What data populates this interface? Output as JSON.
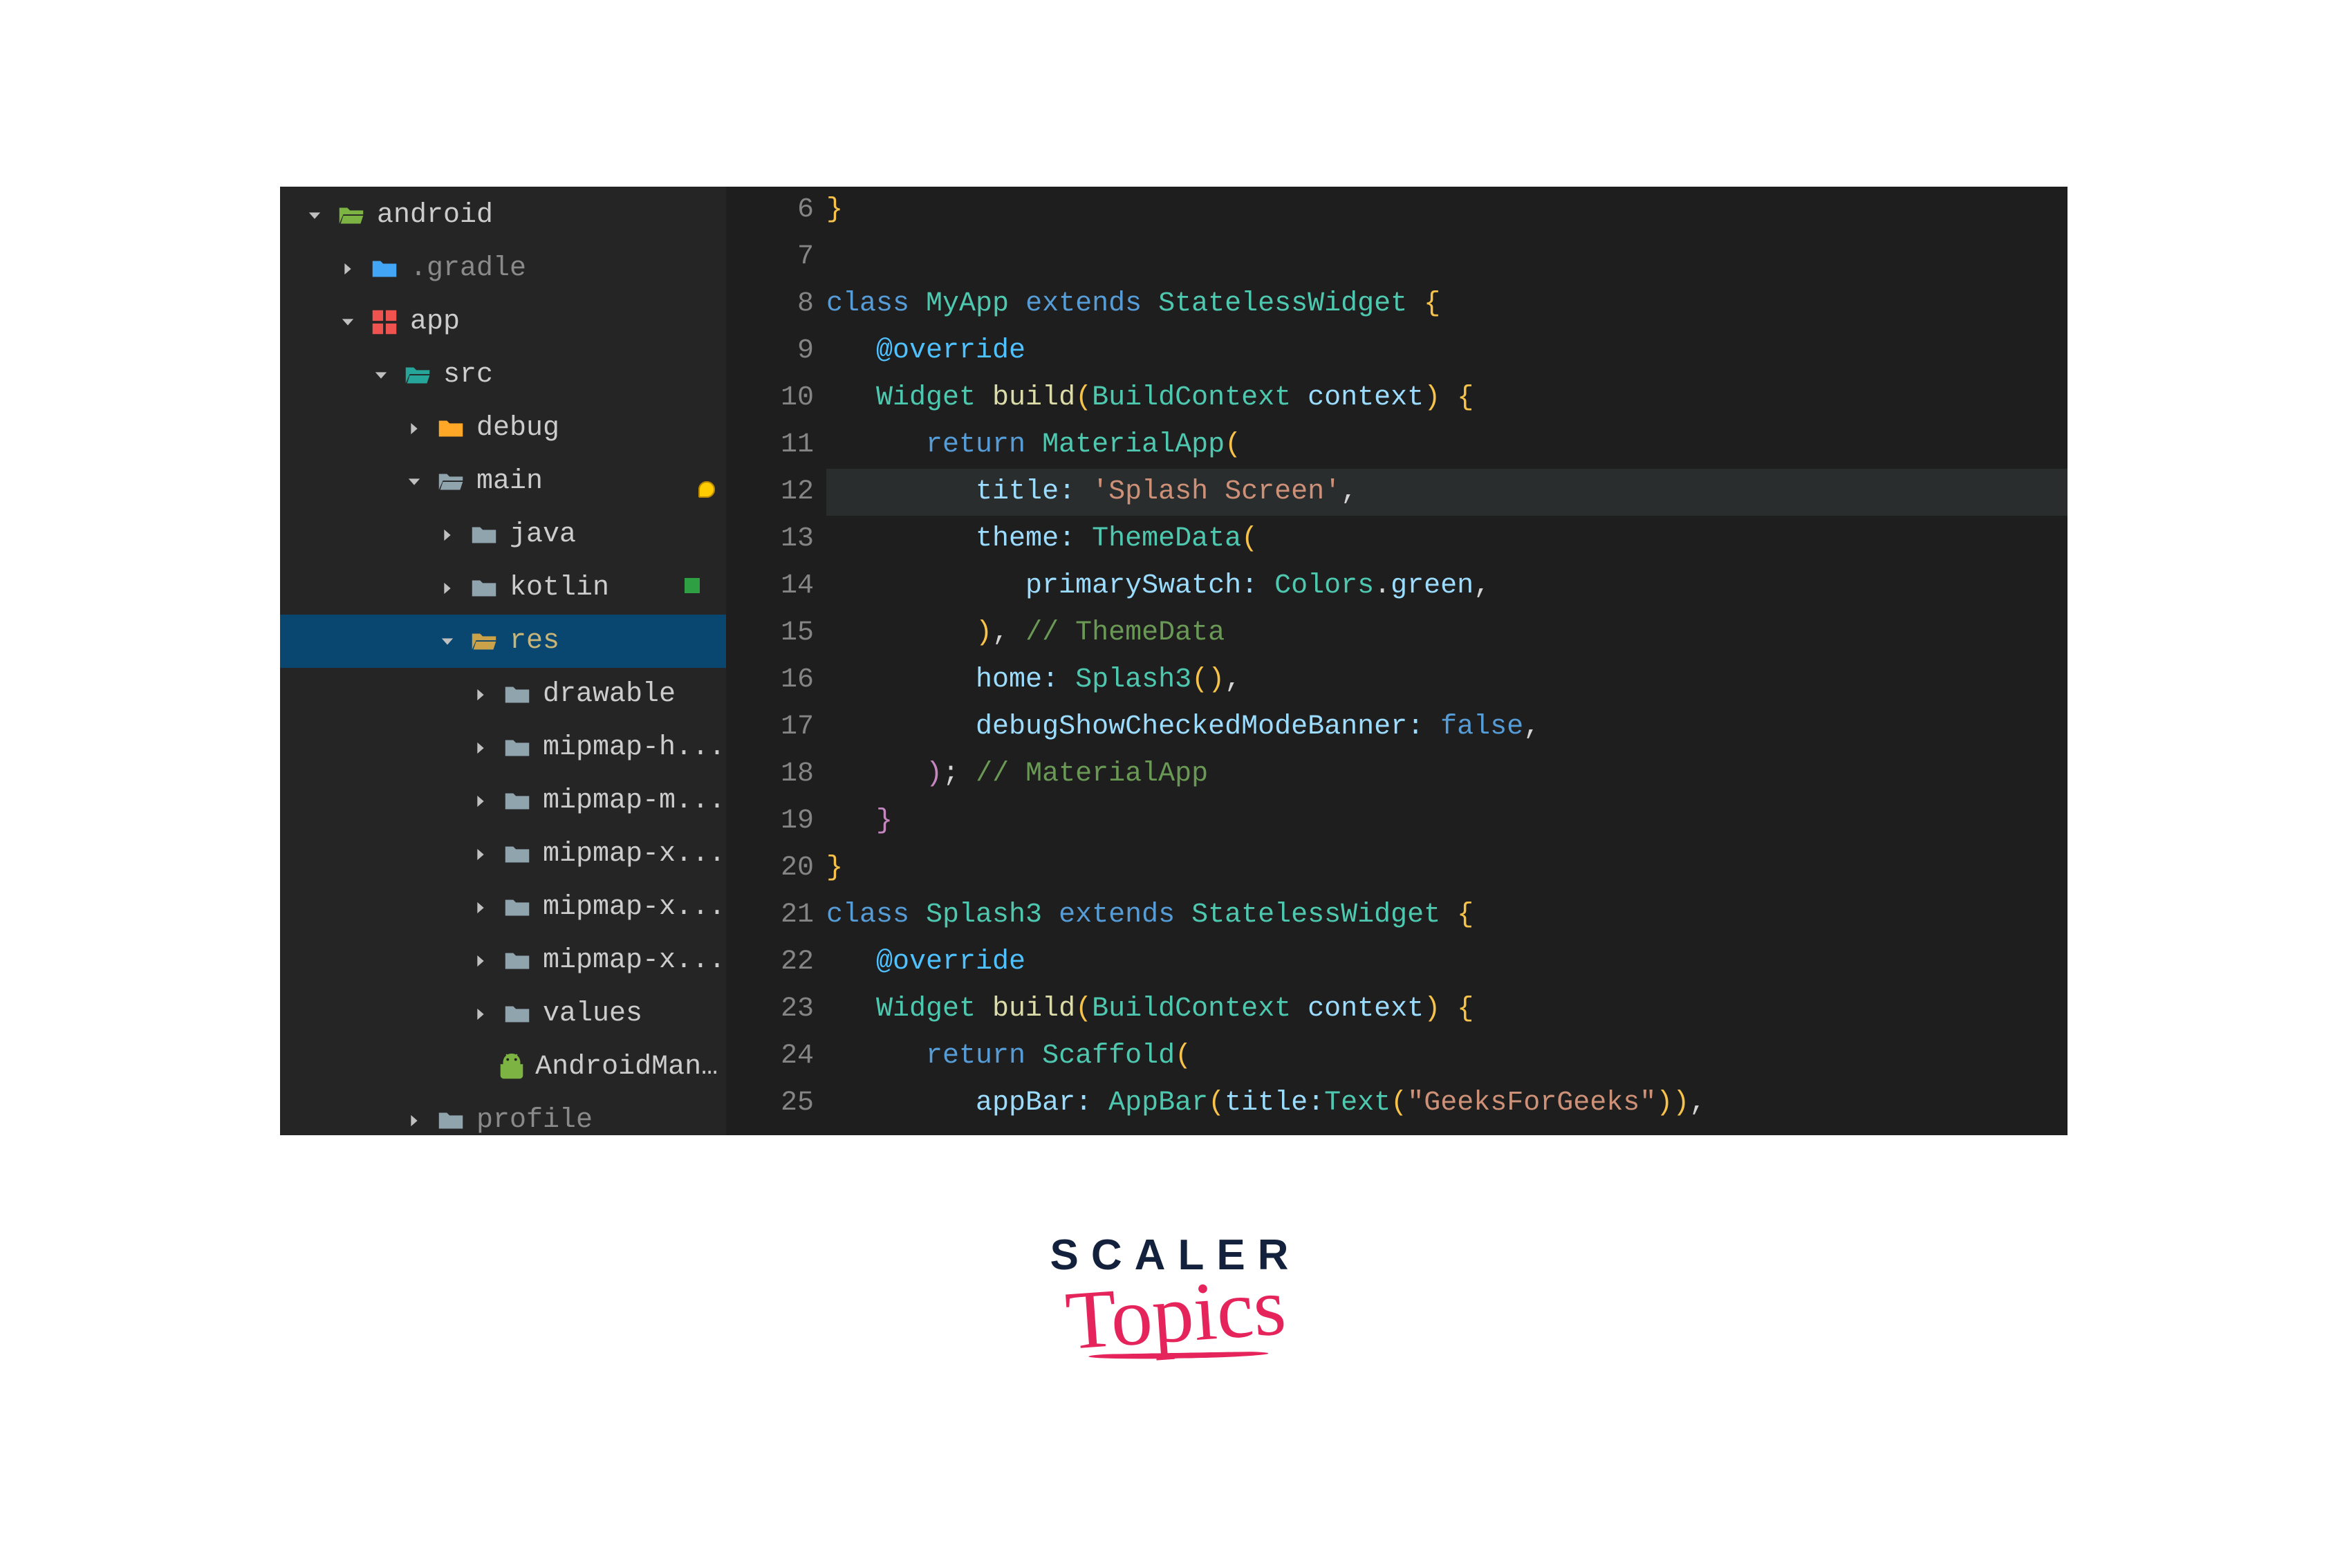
{
  "logo": {
    "line1": "SCALER",
    "line2": "Topics"
  },
  "tree": [
    {
      "depth": 0,
      "twisty": "down",
      "iconColor": "#7cb342",
      "iconType": "folder-open",
      "label": "android",
      "selected": false
    },
    {
      "depth": 1,
      "twisty": "right",
      "iconColor": "#42a5f5",
      "iconType": "folder",
      "label": ".gradle",
      "fade": true
    },
    {
      "depth": 1,
      "twisty": "down",
      "iconColor": "#ef5350",
      "iconType": "grid",
      "label": "app"
    },
    {
      "depth": 2,
      "twisty": "down",
      "iconColor": "#26a69a",
      "iconType": "folder-open",
      "label": "src"
    },
    {
      "depth": 3,
      "twisty": "right",
      "iconColor": "#ffa726",
      "iconType": "folder",
      "label": "debug"
    },
    {
      "depth": 3,
      "twisty": "down",
      "iconColor": "#90a4ae",
      "iconType": "folder-open",
      "label": "main"
    },
    {
      "depth": 4,
      "twisty": "right",
      "iconColor": "#90a4ae",
      "iconType": "folder",
      "label": "java"
    },
    {
      "depth": 4,
      "twisty": "right",
      "iconColor": "#90a4ae",
      "iconType": "folder",
      "label": "kotlin"
    },
    {
      "depth": 4,
      "twisty": "down",
      "iconColor": "#c9a24a",
      "iconType": "folder-open",
      "label": "res",
      "selected": true,
      "res": true
    },
    {
      "depth": 5,
      "twisty": "right",
      "iconColor": "#90a4ae",
      "iconType": "folder",
      "label": "drawable"
    },
    {
      "depth": 5,
      "twisty": "right",
      "iconColor": "#90a4ae",
      "iconType": "folder",
      "label": "mipmap-h..."
    },
    {
      "depth": 5,
      "twisty": "right",
      "iconColor": "#90a4ae",
      "iconType": "folder",
      "label": "mipmap-m..."
    },
    {
      "depth": 5,
      "twisty": "right",
      "iconColor": "#90a4ae",
      "iconType": "folder",
      "label": "mipmap-x..."
    },
    {
      "depth": 5,
      "twisty": "right",
      "iconColor": "#90a4ae",
      "iconType": "folder",
      "label": "mipmap-x..."
    },
    {
      "depth": 5,
      "twisty": "right",
      "iconColor": "#90a4ae",
      "iconType": "folder",
      "label": "mipmap-x..."
    },
    {
      "depth": 5,
      "twisty": "right",
      "iconColor": "#90a4ae",
      "iconType": "folder",
      "label": "values"
    },
    {
      "depth": 5,
      "twisty": "none",
      "iconColor": "#7cb342",
      "iconType": "android",
      "label": "AndroidMan..."
    },
    {
      "depth": 3,
      "twisty": "right",
      "iconColor": "#90a4ae",
      "iconType": "folder",
      "label": "profile",
      "fade": true
    }
  ],
  "gutter": {
    "start": 6,
    "end": 25,
    "bulbLine": 12,
    "modifiedLine": 14
  },
  "code": [
    {
      "n": 6,
      "indent": 0,
      "tokens": [
        {
          "t": "}",
          "c": "p"
        }
      ]
    },
    {
      "n": 7,
      "indent": 0,
      "tokens": []
    },
    {
      "n": 8,
      "indent": 0,
      "tokens": [
        {
          "t": "class ",
          "c": "kw"
        },
        {
          "t": "MyApp ",
          "c": "ty"
        },
        {
          "t": "extends ",
          "c": "kw"
        },
        {
          "t": "StatelessWidget ",
          "c": "ty"
        },
        {
          "t": "{",
          "c": "p"
        }
      ]
    },
    {
      "n": 9,
      "indent": 1,
      "tokens": [
        {
          "t": "@override",
          "c": "ov"
        }
      ]
    },
    {
      "n": 10,
      "indent": 1,
      "tokens": [
        {
          "t": "Widget ",
          "c": "ty"
        },
        {
          "t": "build",
          "c": "fn"
        },
        {
          "t": "(",
          "c": "p"
        },
        {
          "t": "BuildContext ",
          "c": "ty"
        },
        {
          "t": "context",
          "c": "id"
        },
        {
          "t": ") {",
          "c": "p"
        }
      ]
    },
    {
      "n": 11,
      "indent": 2,
      "tokens": [
        {
          "t": "return ",
          "c": "kw"
        },
        {
          "t": "MaterialApp",
          "c": "ty"
        },
        {
          "t": "(",
          "c": "p"
        }
      ]
    },
    {
      "n": 12,
      "indent": 3,
      "hl": true,
      "tokens": [
        {
          "t": "title: ",
          "c": "np"
        },
        {
          "t": "'Splash Screen'",
          "c": "st"
        },
        {
          "t": ",",
          "c": ""
        }
      ]
    },
    {
      "n": 13,
      "indent": 3,
      "tokens": [
        {
          "t": "theme: ",
          "c": "np"
        },
        {
          "t": "ThemeData",
          "c": "ty"
        },
        {
          "t": "(",
          "c": "p"
        }
      ]
    },
    {
      "n": 14,
      "indent": 4,
      "tokens": [
        {
          "t": "primarySwatch: ",
          "c": "np"
        },
        {
          "t": "Colors",
          "c": "en"
        },
        {
          "t": ".",
          "c": ""
        },
        {
          "t": "green",
          "c": "mem"
        },
        {
          "t": ",",
          "c": ""
        }
      ]
    },
    {
      "n": 15,
      "indent": 3,
      "tokens": [
        {
          "t": ")",
          "c": "p"
        },
        {
          "t": ", ",
          "c": ""
        },
        {
          "t": "// ThemeData",
          "c": "cm"
        }
      ]
    },
    {
      "n": 16,
      "indent": 3,
      "tokens": [
        {
          "t": "home: ",
          "c": "np"
        },
        {
          "t": "Splash3",
          "c": "ty"
        },
        {
          "t": "()",
          "c": "p"
        },
        {
          "t": ",",
          "c": ""
        }
      ]
    },
    {
      "n": 17,
      "indent": 3,
      "tokens": [
        {
          "t": "debugShowCheckedModeBanner: ",
          "c": "np"
        },
        {
          "t": "false",
          "c": "bl"
        },
        {
          "t": ",",
          "c": ""
        }
      ]
    },
    {
      "n": 18,
      "indent": 2,
      "tokens": [
        {
          "t": ")",
          "c": "bp"
        },
        {
          "t": "; ",
          "c": ""
        },
        {
          "t": "// MaterialApp",
          "c": "cm"
        }
      ]
    },
    {
      "n": 19,
      "indent": 1,
      "tokens": [
        {
          "t": "}",
          "c": "bp"
        }
      ]
    },
    {
      "n": 20,
      "indent": 0,
      "tokens": [
        {
          "t": "}",
          "c": "p"
        }
      ]
    },
    {
      "n": 21,
      "indent": 0,
      "tokens": [
        {
          "t": "class ",
          "c": "kw"
        },
        {
          "t": "Splash3 ",
          "c": "ty"
        },
        {
          "t": "extends ",
          "c": "kw"
        },
        {
          "t": "StatelessWidget ",
          "c": "ty"
        },
        {
          "t": "{",
          "c": "p"
        }
      ]
    },
    {
      "n": 22,
      "indent": 1,
      "tokens": [
        {
          "t": "@override",
          "c": "ov"
        }
      ]
    },
    {
      "n": 23,
      "indent": 1,
      "tokens": [
        {
          "t": "Widget ",
          "c": "ty"
        },
        {
          "t": "build",
          "c": "fn"
        },
        {
          "t": "(",
          "c": "p"
        },
        {
          "t": "BuildContext ",
          "c": "ty"
        },
        {
          "t": "context",
          "c": "id"
        },
        {
          "t": ") {",
          "c": "p"
        }
      ]
    },
    {
      "n": 24,
      "indent": 2,
      "tokens": [
        {
          "t": "return ",
          "c": "kw"
        },
        {
          "t": "Scaffold",
          "c": "ty"
        },
        {
          "t": "(",
          "c": "p"
        }
      ]
    },
    {
      "n": 25,
      "indent": 3,
      "tokens": [
        {
          "t": "appBar: ",
          "c": "np"
        },
        {
          "t": "AppBar",
          "c": "ty"
        },
        {
          "t": "(",
          "c": "p"
        },
        {
          "t": "title:",
          "c": "np"
        },
        {
          "t": "Text",
          "c": "ty"
        },
        {
          "t": "(",
          "c": "p"
        },
        {
          "t": "\"GeeksForGeeks\"",
          "c": "st"
        },
        {
          "t": "))",
          "c": "p"
        },
        {
          "t": ",",
          "c": ""
        }
      ]
    }
  ]
}
